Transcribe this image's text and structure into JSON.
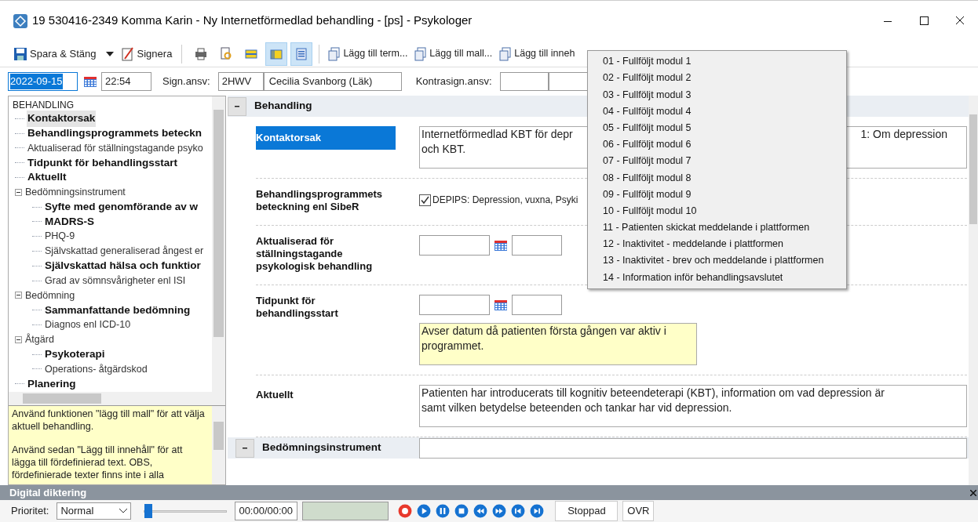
{
  "window": {
    "title": "19 530416-2349 Komma Karin - Ny Internetförmedlad behandling - [ps] - Psykologer"
  },
  "toolbar": {
    "save": "Spara & Stäng",
    "sign": "Signera",
    "icon_buttons": [
      {
        "kind": "printer",
        "selected": false
      },
      {
        "kind": "preview",
        "selected": false
      },
      {
        "kind": "bar",
        "selected": false
      },
      {
        "kind": "panel",
        "selected": true
      },
      {
        "kind": "list",
        "selected": true
      }
    ],
    "add_buttons": [
      "Lägg till term...",
      "Lägg till mall...",
      "Lägg till inneh"
    ]
  },
  "header": {
    "date": "2022-09-15",
    "time": "22:54",
    "sign_label": "Sign.ansv:",
    "sign_code": "2HWV",
    "sign_name": "Cecilia Svanborg (Läk)",
    "countersign_label": "Kontrasign.ansv:"
  },
  "tree": {
    "root": "BEHANDLING",
    "items": [
      {
        "label": "Kontaktorsak",
        "filled": true,
        "selected": true
      },
      {
        "label": "Behandlingsprogrammets beteckn",
        "filled": true,
        "selected": false
      },
      {
        "label": "Aktualiserad för ställningstagande psyko",
        "filled": false,
        "selected": false
      },
      {
        "label": "Tidpunkt för behandlingsstart",
        "filled": true,
        "selected": false
      },
      {
        "label": "Aktuellt",
        "filled": true,
        "selected": false
      },
      {
        "label": "Bedömningsinstrument",
        "filled": false,
        "selected": false,
        "expanded": true,
        "children": [
          {
            "label": "Syfte med genomförande av w",
            "filled": true,
            "selected": false
          },
          {
            "label": "MADRS-S",
            "filled": true,
            "selected": false
          },
          {
            "label": "PHQ-9",
            "filled": false,
            "selected": false
          },
          {
            "label": "Självskattad generaliserad ångest er",
            "filled": false,
            "selected": false
          },
          {
            "label": "Självskattad hälsa och funktior",
            "filled": true,
            "selected": false
          },
          {
            "label": "Grad av sömnsvårigheter enl ISI",
            "filled": false,
            "selected": false
          }
        ]
      },
      {
        "label": "Bedömning",
        "filled": false,
        "selected": false,
        "expanded": true,
        "children": [
          {
            "label": "Sammanfattande bedömning",
            "filled": true,
            "selected": false
          },
          {
            "label": "Diagnos enl ICD-10",
            "filled": false,
            "selected": false
          }
        ]
      },
      {
        "label": "Åtgärd",
        "filled": false,
        "selected": false,
        "expanded": true,
        "children": [
          {
            "label": "Psykoterapi",
            "filled": true,
            "selected": false
          },
          {
            "label": "Operations- åtgärdskod",
            "filled": false,
            "selected": false
          }
        ]
      },
      {
        "label": "Planering",
        "filled": true,
        "selected": false
      }
    ]
  },
  "hint": [
    "Använd funktionen \"lägg till mall\" för att välja aktuell behandling.",
    "Använd sedan \"Lägg till innehåll\" för att lägga till fördefinierad text. OBS, fördefinierade texter finns inte i alla"
  ],
  "sections": [
    {
      "title": "Behandling",
      "expanded": true,
      "fields": [
        {
          "kind": "text",
          "label": "Kontaktorsak",
          "selected": true,
          "lines": [
            {
              "left": "Internetförmedlad KBT för depr",
              "right": "1: Om depression"
            },
            {
              "left": "och KBT."
            }
          ]
        },
        {
          "kind": "checkbox",
          "label": "Behandlingsprogrammets beteckning enl SibeR",
          "selected": false,
          "checked": true,
          "option": "DEPIPS: Depression, vuxna, Psyki"
        },
        {
          "kind": "datetime",
          "label": "Aktualiserad för ställningstagande psykologisk behandling",
          "selected": false
        },
        {
          "kind": "datetime",
          "label": "Tidpunkt för behandlingsstart",
          "selected": false,
          "note": "Avser datum då patienten första gången var aktiv i programmet."
        },
        {
          "kind": "text",
          "label": "Aktuellt",
          "selected": false,
          "lines": [
            {
              "left": "Patienten har introducerats till kognitiv beteendeterapi (KBT), information om vad depression är"
            },
            {
              "left": "samt vilken betydelse beteenden och tankar har vid depression."
            }
          ]
        }
      ]
    },
    {
      "title": "Bedömningsinstrument",
      "expanded": true
    }
  ],
  "menu": [
    "01 - Fullföljt modul 1",
    "02 - Fullföljt modul 2",
    "03 - Fullföljt modul 3",
    "04 - Fullföljt modul 4",
    "05 - Fullföljt modul 5",
    "06 - Fullföljt modul 6",
    "07 - Fullföljt modul 7",
    "08 - Fullföljt modul 8",
    "09 - Fullföljt modul 9",
    "10 - Fullföljt modul 10",
    "11 - Patienten skickat meddelande i plattformen",
    "12 - Inaktivitet - meddelande i plattformen",
    "13 - Inaktivitet - brev och meddelande i plattformen",
    "14 - Information inför behandlingsavslutet"
  ],
  "dictation": {
    "title": "Digital diktering",
    "priority_label": "Prioritet:",
    "priority": "Normal",
    "position": {
      "level": 0.04
    },
    "time": "00:00/00:00",
    "status": "Stoppad",
    "mode": "OVR",
    "controls": [
      {
        "kind": "record"
      },
      {
        "kind": "play"
      },
      {
        "kind": "pause"
      },
      {
        "kind": "stop"
      },
      {
        "kind": "rewind"
      },
      {
        "kind": "forward"
      },
      {
        "kind": "start"
      },
      {
        "kind": "end"
      }
    ]
  }
}
